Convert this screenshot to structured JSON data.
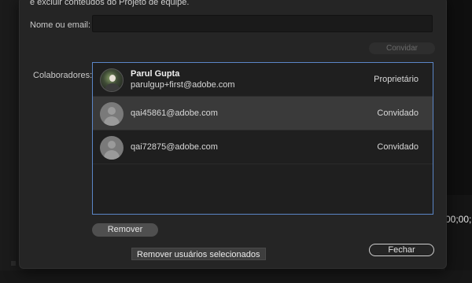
{
  "dialog": {
    "intro_text": "e excluir conteúdos do Projeto de equipe.",
    "email_label": "Nome ou email:",
    "email_value": "",
    "invite_label": "Convidar",
    "collaborators_label": "Colaboradores:",
    "collaborators": [
      {
        "name": "Parul Gupta",
        "email": "parulgup+first@adobe.com",
        "role": "Proprietário",
        "avatar": "photo-avatar",
        "selected": false
      },
      {
        "name": "",
        "email": "qai45861@adobe.com",
        "role": "Convidado",
        "avatar": "generic-user-icon",
        "selected": true
      },
      {
        "name": "",
        "email": "qai72875@adobe.com",
        "role": "Convidado",
        "avatar": "generic-user-icon",
        "selected": false
      }
    ],
    "remove_label": "Remover",
    "remove_tooltip": "Remover usuários selecionados",
    "close_label": "Fechar"
  },
  "background": {
    "timecode": "00;00;"
  },
  "colors": {
    "list_border": "#5b86c7",
    "selected_row": "#3a3a3a",
    "dialog_bg": "#252525"
  }
}
